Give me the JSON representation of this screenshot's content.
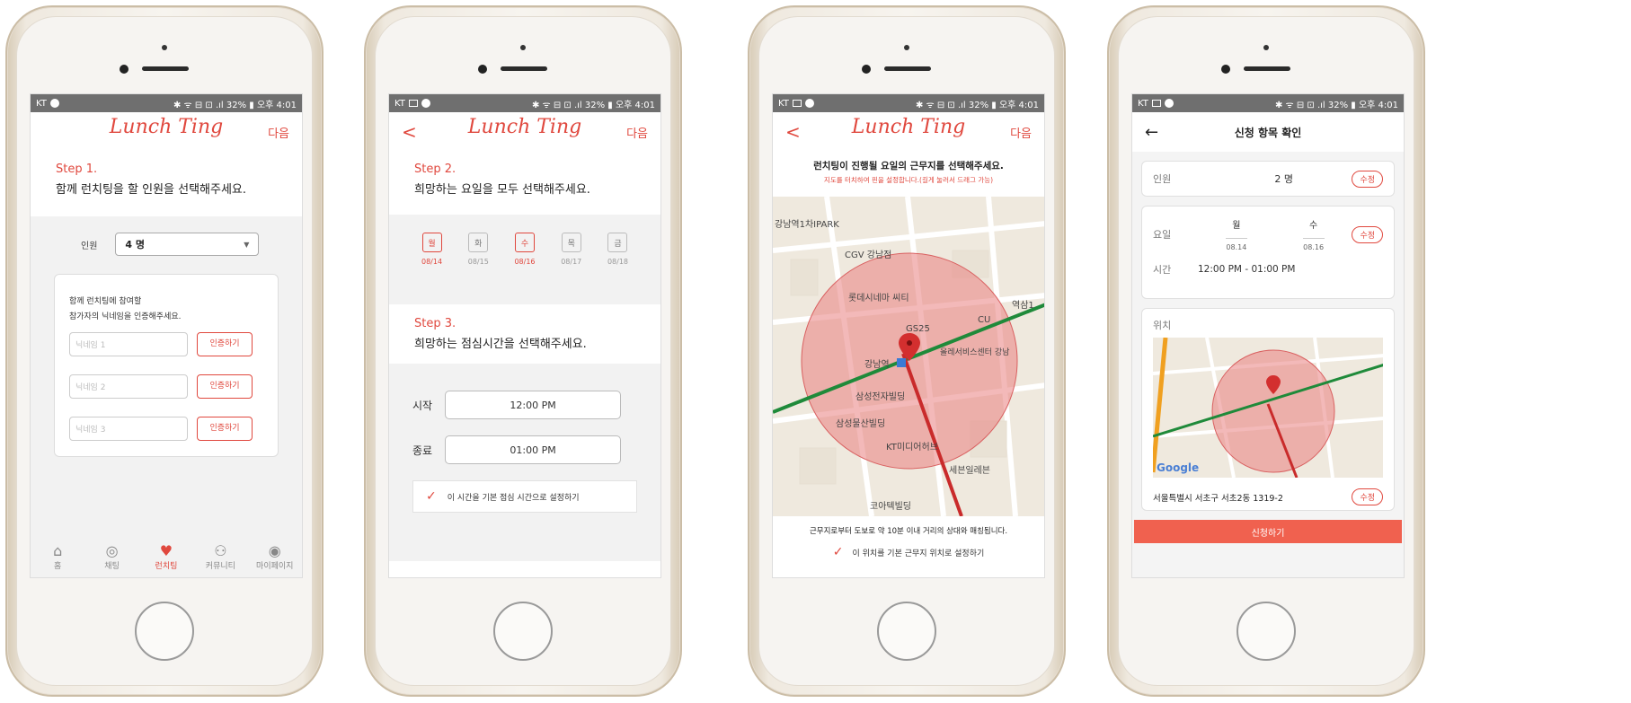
{
  "status": {
    "carrier": "KT",
    "right": "✱ ᯤ ⊟ ⊡ .ıl 32% ▮ 오후 4:01"
  },
  "logo_text": "Lunch Ting",
  "next_label": "다음",
  "back_label": "<",
  "screen1": {
    "step_title": "Step 1.",
    "step_desc": "함께 런치팅을 할 인원을 선택해주세요.",
    "people_label": "인원",
    "people_value": "4 명",
    "verify_title_1": "함께 런치팅에 참여할",
    "verify_title_2": "참가자의 닉네임을 인증해주세요.",
    "nickname_fields": [
      {
        "placeholder": "닉네임 1",
        "button": "인증하기"
      },
      {
        "placeholder": "닉네임 2",
        "button": "인증하기"
      },
      {
        "placeholder": "닉네임 3",
        "button": "인증하기"
      }
    ],
    "tabs": [
      {
        "icon": "⌂",
        "label": "홈"
      },
      {
        "icon": "◎",
        "label": "채팅"
      },
      {
        "icon": "♥",
        "label": "런치팅"
      },
      {
        "icon": "⚇",
        "label": "커뮤니티"
      },
      {
        "icon": "◉",
        "label": "마이페이지"
      }
    ]
  },
  "screen2": {
    "step2_title": "Step 2.",
    "step2_desc": "희망하는 요일을 모두 선택해주세요.",
    "days": [
      {
        "day": "월",
        "date": "08/14"
      },
      {
        "day": "화",
        "date": "08/15"
      },
      {
        "day": "수",
        "date": "08/16"
      },
      {
        "day": "목",
        "date": "08/17"
      },
      {
        "day": "금",
        "date": "08/18"
      }
    ],
    "step3_title": "Step 3.",
    "step3_desc": "희망하는 점심시간을 선택해주세요.",
    "start_label": "시작",
    "start_value": "12:00 PM",
    "end_label": "종료",
    "end_value": "01:00 PM",
    "default_check": "이 시간을 기본 점심 시간으로 설정하기"
  },
  "screen3": {
    "title": "런치팅이 진행될 요일의 근무지를 선택해주세요.",
    "subtitle": "지도를 터치하여 핀을 설정합니다.(길게 눌러서 드래그 가능)",
    "map_labels": {
      "park": "강남역1차IPARK",
      "cgv": "CGV 강남점",
      "lotte": "롯데시네마 씨티",
      "cu": "CU",
      "station_right": "역삼1",
      "gs": "GS25",
      "gangnam": "강남역",
      "olle": "올레서비스센터 강남",
      "samsung": "삼성전자빌딩",
      "samsung_life": "삼성물산빌딩",
      "kt": "KT미디어허브",
      "seven": "세븐일레븐",
      "bottom": "코아텍빌딩"
    },
    "info": "근무지로부터 도보로 약 10분 이내 거리의 상대와 매칭됩니다.",
    "default_check": "이 위치를 기본 근무지 위치로 설정하기"
  },
  "screen4": {
    "title": "신청 항목 확인",
    "people_label": "인원",
    "people_value": "2 명",
    "edit": "수정",
    "day_label": "요일",
    "days": [
      {
        "day": "월",
        "date": "08.14"
      },
      {
        "day": "수",
        "date": "08.16"
      }
    ],
    "time_label": "시간",
    "time_value": "12:00 PM - 01:00 PM",
    "location_label": "위치",
    "address": "서울특별시 서초구 서초2동 1319-2",
    "google": "Google",
    "submit": "신청하기"
  }
}
